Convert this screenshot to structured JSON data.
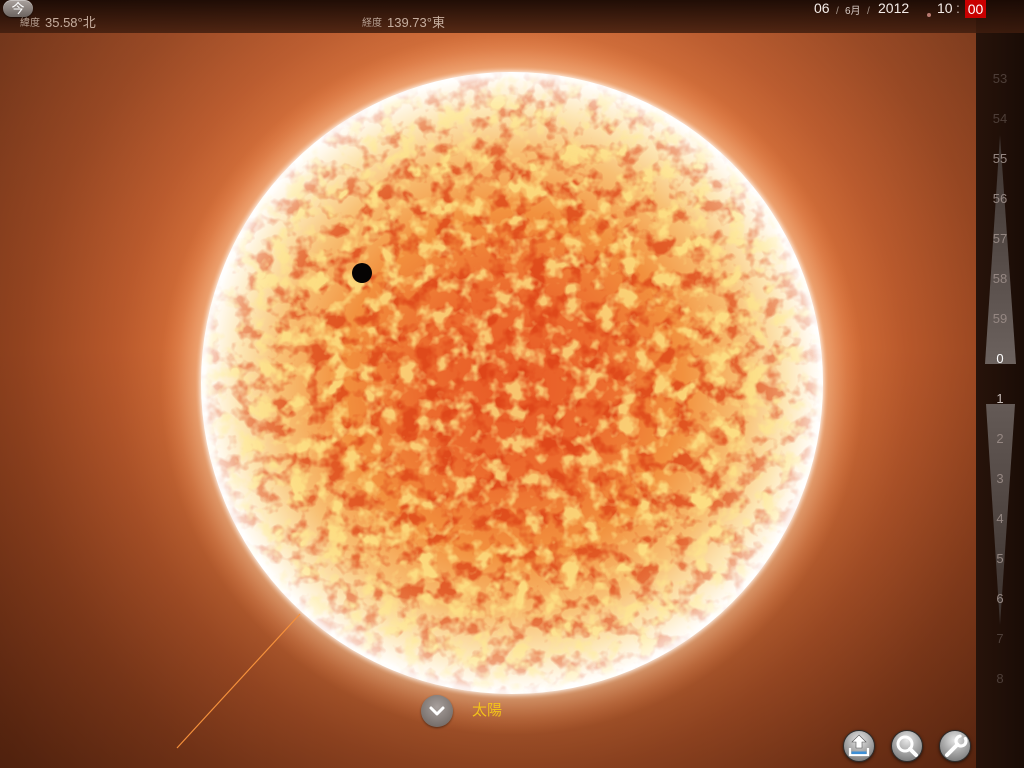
{
  "top_bar": {
    "now_button_label": "今",
    "latitude": {
      "label": "緯度",
      "value": "35.58°北"
    },
    "longitude": {
      "label": "経度",
      "value": "139.73°東"
    },
    "date": {
      "day": "06",
      "month": "6月",
      "year": "2012",
      "separator": "/"
    },
    "time": {
      "hour": "10",
      "separator": ":",
      "minute": "00"
    }
  },
  "selected_object": {
    "name": "太陽",
    "expand_icon": "chevron-down-icon"
  },
  "minute_scale": {
    "labels": [
      "53",
      "54",
      "55",
      "56",
      "57",
      "58",
      "59",
      "0",
      "1",
      "2",
      "3",
      "4",
      "5",
      "6",
      "7",
      "8"
    ],
    "selected_index": 7
  },
  "toolbar": {
    "buttons": [
      {
        "icon": "share-icon"
      },
      {
        "icon": "search-icon"
      },
      {
        "icon": "wrench-icon"
      }
    ]
  },
  "colors": {
    "accent": "#c80000",
    "object_label": "#f2c21a"
  }
}
